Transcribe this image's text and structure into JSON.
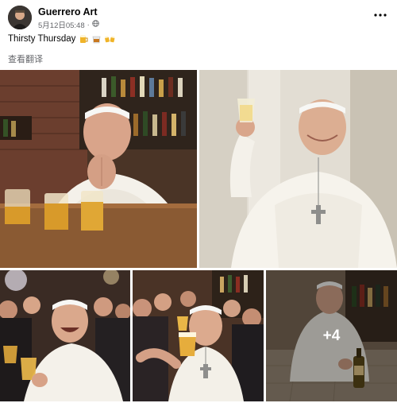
{
  "header": {
    "author": "Guerrero Art",
    "timestamp": "5月12日05:48",
    "privacy_icon": "globe-icon",
    "more_icon": "more-options-icon"
  },
  "post": {
    "caption": "Thirsty Thursday",
    "caption_emojis": [
      "beer-mug-emoji",
      "whiskey-glass-emoji",
      "clinking-beers-emoji"
    ],
    "translate_label": "查看翻译"
  },
  "photos": {
    "items": [
      {
        "id": "photo-1"
      },
      {
        "id": "photo-2"
      },
      {
        "id": "photo-3"
      },
      {
        "id": "photo-4"
      },
      {
        "id": "photo-5"
      }
    ],
    "more_count": "+4"
  },
  "colors": {
    "text_primary": "#050505",
    "text_secondary": "#65676b",
    "vestment_white": "#f4f1ea",
    "beer_amber": "#d89a2a"
  }
}
